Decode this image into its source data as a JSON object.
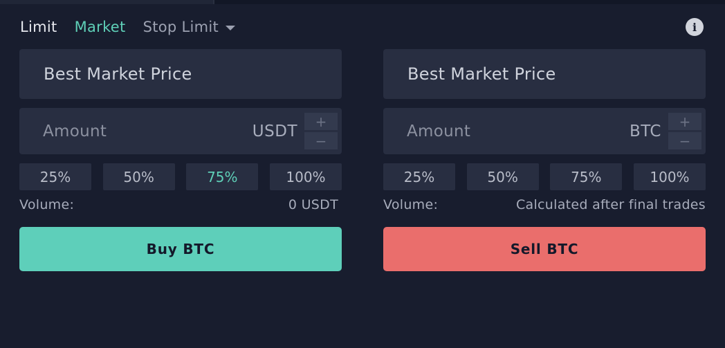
{
  "order_tabs": {
    "limit": "Limit",
    "market": "Market",
    "stop_limit": "Stop Limit"
  },
  "info_icon": {
    "glyph": "i",
    "name": "info-icon"
  },
  "buy_panel": {
    "price": "Best Market Price",
    "amount_placeholder": "Amount",
    "amount_value": "",
    "unit": "USDT",
    "step_plus": "+",
    "step_minus": "−",
    "percents": [
      "25%",
      "50%",
      "75%",
      "100%"
    ],
    "active_percent": "75%",
    "volume_label": "Volume:",
    "volume_value": "0 USDT",
    "action_label": "Buy BTC",
    "action_color": "#5ecfba"
  },
  "sell_panel": {
    "price": "Best Market Price",
    "amount_placeholder": "Amount",
    "amount_value": "",
    "unit": "BTC",
    "step_plus": "+",
    "step_minus": "−",
    "percents": [
      "25%",
      "50%",
      "75%",
      "100%"
    ],
    "active_percent": "",
    "volume_label": "Volume:",
    "volume_value": "Calculated after final trades",
    "action_label": "Sell BTC",
    "action_color": "#ea6e6c"
  },
  "colors": {
    "background": "#181d2e",
    "field": "#282e41",
    "accent": "#5fd0b8",
    "sell": "#ea6e6c"
  }
}
